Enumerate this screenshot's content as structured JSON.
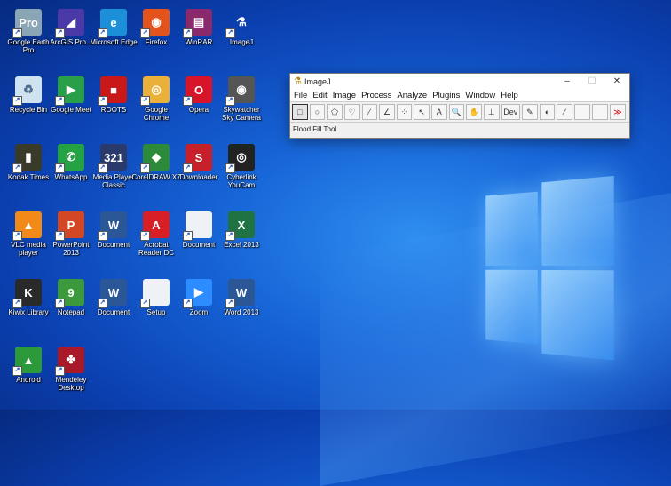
{
  "desktop": {
    "icons": [
      {
        "label": "Google Earth Pro",
        "icon": "google-earth-icon",
        "bg": "#8aa6b5",
        "glyph": "Pro"
      },
      {
        "label": "ArcGIS Pro...",
        "icon": "arcgis-icon",
        "bg": "#4a3aa8",
        "glyph": "◢"
      },
      {
        "label": "Microsoft Edge",
        "icon": "edge-icon",
        "bg": "#1b8fd8",
        "glyph": "e"
      },
      {
        "label": "Firefox",
        "icon": "firefox-icon",
        "bg": "#e2541c",
        "glyph": "◉"
      },
      {
        "label": "WinRAR",
        "icon": "winrar-icon",
        "bg": "#8a2a6a",
        "glyph": "▤"
      },
      {
        "label": "ImageJ",
        "icon": "imagej-icon",
        "bg": "transparent",
        "glyph": "⚗"
      },
      {
        "label": "Recycle Bin",
        "icon": "recycle-bin-icon",
        "bg": "#cfe2f0",
        "glyph": "♻"
      },
      {
        "label": "Google Meet",
        "icon": "google-meet-icon",
        "bg": "#2a9f4a",
        "glyph": "▶"
      },
      {
        "label": "ROOTS",
        "icon": "roots-icon",
        "bg": "#c81818",
        "glyph": "■"
      },
      {
        "label": "Google Chrome",
        "icon": "chrome-icon",
        "bg": "#e9b13a",
        "glyph": "◎"
      },
      {
        "label": "Opera",
        "icon": "opera-icon",
        "bg": "#d8142a",
        "glyph": "O"
      },
      {
        "label": "Skywatcher Sky Camera",
        "icon": "skycamera-icon",
        "bg": "#555",
        "glyph": "◉"
      },
      {
        "label": "Kodak Times",
        "icon": "kodak-icon",
        "bg": "#3a3a2a",
        "glyph": "▮"
      },
      {
        "label": "WhatsApp",
        "icon": "whatsapp-icon",
        "bg": "#25a244",
        "glyph": "✆"
      },
      {
        "label": "Media Player Classic",
        "icon": "mpc-icon",
        "bg": "#2a3a6a",
        "glyph": "321"
      },
      {
        "label": "CorelDRAW X7",
        "icon": "coreldraw-icon",
        "bg": "#2c8a3a",
        "glyph": "◆"
      },
      {
        "label": "Downloader",
        "icon": "downloader-icon",
        "bg": "#c8202a",
        "glyph": "S"
      },
      {
        "label": "Cyberlink YouCam",
        "icon": "youcam-icon",
        "bg": "#222",
        "glyph": "◎"
      },
      {
        "label": "VLC media player",
        "icon": "vlc-icon",
        "bg": "#f28a1a",
        "glyph": "▲"
      },
      {
        "label": "PowerPoint 2013",
        "icon": "powerpoint-icon",
        "bg": "#d24726",
        "glyph": "P"
      },
      {
        "label": "Document",
        "icon": "word-doc-icon",
        "bg": "#2b5797",
        "glyph": "W"
      },
      {
        "label": "Acrobat Reader DC",
        "icon": "acrobat-icon",
        "bg": "#d71f25",
        "glyph": "A"
      },
      {
        "label": "Document",
        "icon": "file-icon",
        "bg": "#eef2f6",
        "glyph": ""
      },
      {
        "label": "Excel 2013",
        "icon": "excel-icon",
        "bg": "#1f7244",
        "glyph": "X"
      },
      {
        "label": "Kiwix Library",
        "icon": "kiwix-icon",
        "bg": "#2a2a2a",
        "glyph": "K"
      },
      {
        "label": "Notepad",
        "icon": "notepad-icon",
        "bg": "#3c9a3c",
        "glyph": "9"
      },
      {
        "label": "Document",
        "icon": "word-doc-icon",
        "bg": "#2b5797",
        "glyph": "W"
      },
      {
        "label": "Setup",
        "icon": "file-icon",
        "bg": "#eef2f6",
        "glyph": ""
      },
      {
        "label": "Zoom",
        "icon": "zoom-icon",
        "bg": "#2d8cff",
        "glyph": "▶"
      },
      {
        "label": "Word 2013",
        "icon": "word-icon",
        "bg": "#2b5797",
        "glyph": "W"
      },
      {
        "label": "Android",
        "icon": "android-icon",
        "bg": "#2c9a3a",
        "glyph": "▲"
      },
      {
        "label": "Mendeley Desktop",
        "icon": "mendeley-icon",
        "bg": "#a81a2a",
        "glyph": "✤"
      }
    ]
  },
  "imagej": {
    "title": "ImageJ",
    "menus": [
      "File",
      "Edit",
      "Image",
      "Process",
      "Analyze",
      "Plugins",
      "Window",
      "Help"
    ],
    "tools": [
      "□",
      "○",
      "⬠",
      "♡",
      "∕",
      "∠",
      "⁘",
      "↖",
      "A",
      "🔍",
      "✋",
      "⊥",
      "Dev",
      "✎",
      "◐",
      "⁄"
    ],
    "more_tools": "≫",
    "status": "Flood Fill Tool",
    "minimize": "–",
    "maximize": "☐",
    "close": "✕"
  }
}
